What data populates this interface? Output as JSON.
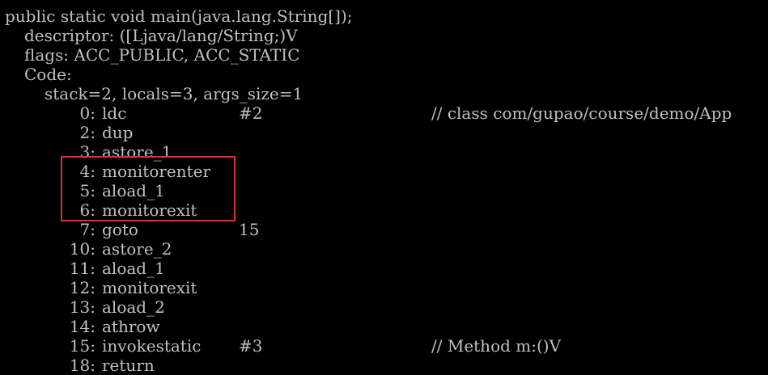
{
  "colors": {
    "background": "#000000",
    "text": "#c0c0c0",
    "highlight_border": "#e03030"
  },
  "header": {
    "signature": "public static void main(java.lang.String[]);",
    "descriptor": "descriptor: ([Ljava/lang/String;)V",
    "flags": "flags: ACC_PUBLIC, ACC_STATIC",
    "code_label": "Code:",
    "stack_info": "stack=2, locals=3, args_size=1"
  },
  "instructions": [
    {
      "offset": "0:",
      "opcode": "ldc",
      "operand": "#2",
      "comment": "// class com/gupao/course/demo/App"
    },
    {
      "offset": "2:",
      "opcode": "dup",
      "operand": "",
      "comment": ""
    },
    {
      "offset": "3:",
      "opcode": "astore_1",
      "operand": "",
      "comment": ""
    },
    {
      "offset": "4:",
      "opcode": "monitorenter",
      "operand": "",
      "comment": ""
    },
    {
      "offset": "5:",
      "opcode": "aload_1",
      "operand": "",
      "comment": ""
    },
    {
      "offset": "6:",
      "opcode": "monitorexit",
      "operand": "",
      "comment": ""
    },
    {
      "offset": "7:",
      "opcode": "goto",
      "operand": "15",
      "comment": ""
    },
    {
      "offset": "10:",
      "opcode": "astore_2",
      "operand": "",
      "comment": ""
    },
    {
      "offset": "11:",
      "opcode": "aload_1",
      "operand": "",
      "comment": ""
    },
    {
      "offset": "12:",
      "opcode": "monitorexit",
      "operand": "",
      "comment": ""
    },
    {
      "offset": "13:",
      "opcode": "aload_2",
      "operand": "",
      "comment": ""
    },
    {
      "offset": "14:",
      "opcode": "athrow",
      "operand": "",
      "comment": ""
    },
    {
      "offset": "15:",
      "opcode": "invokestatic",
      "operand": "#3",
      "comment": "// Method m:()V"
    },
    {
      "offset": "18:",
      "opcode": "return",
      "operand": "",
      "comment": ""
    }
  ]
}
